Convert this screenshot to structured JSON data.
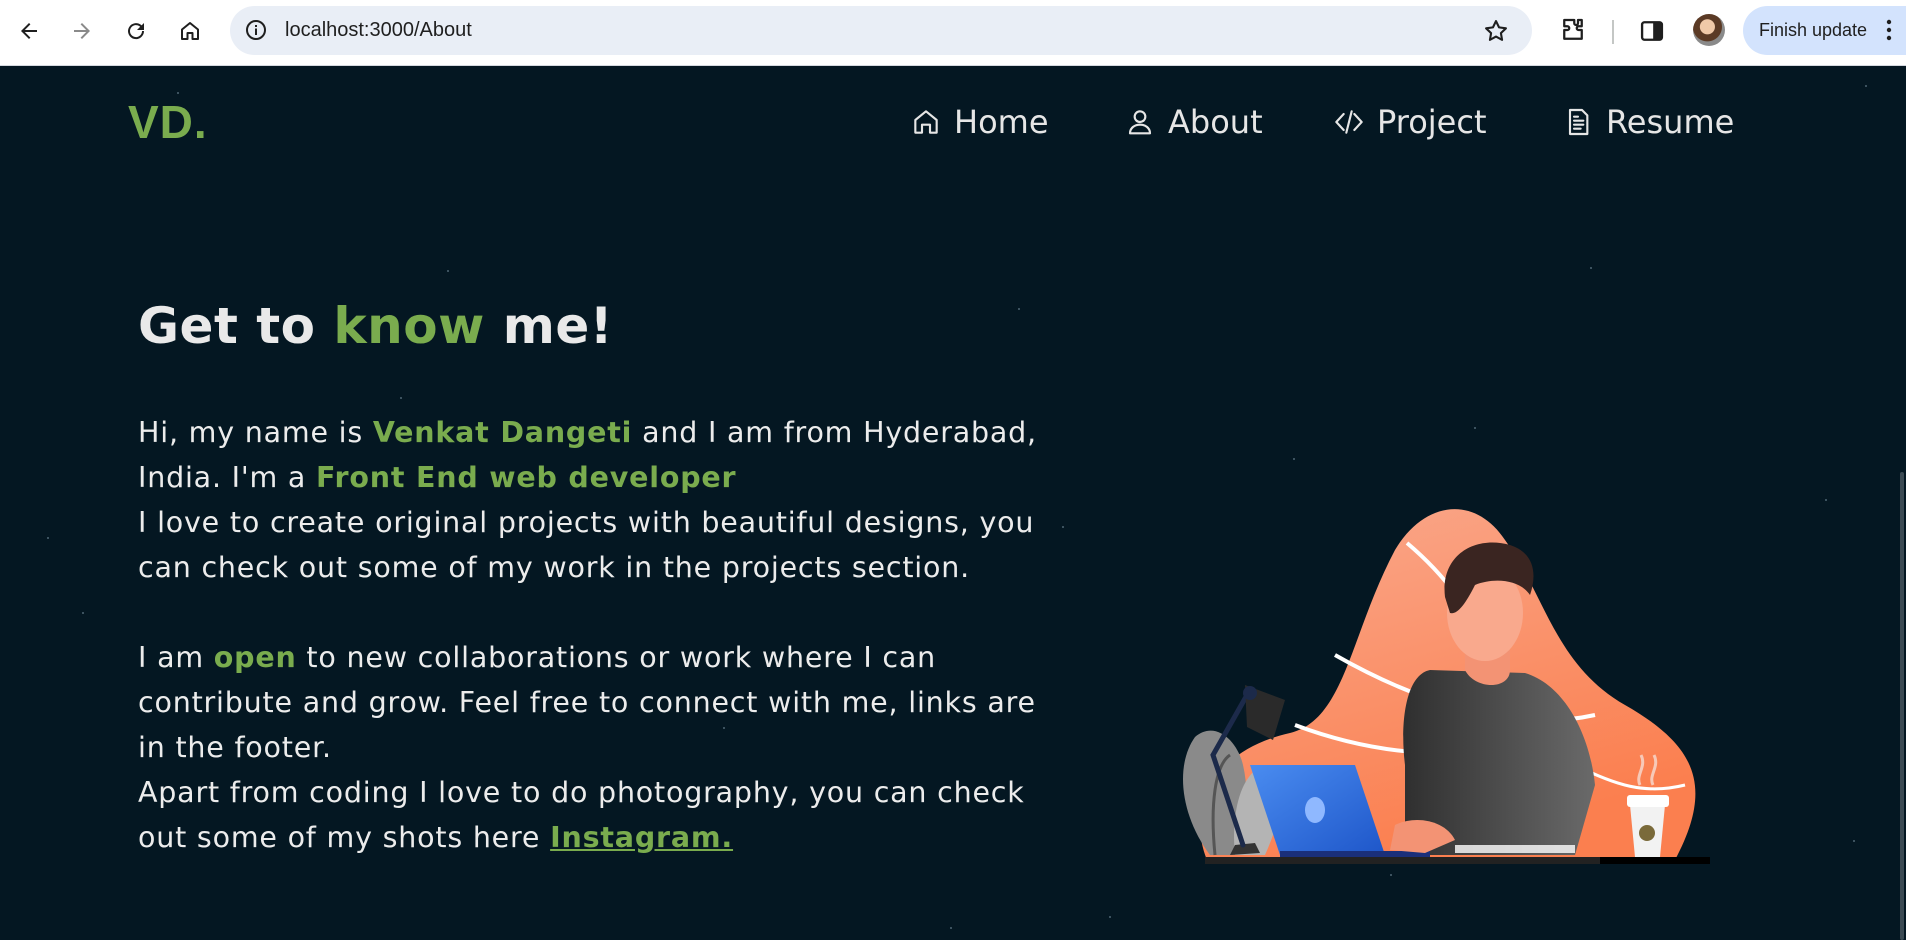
{
  "browser": {
    "url": "localhost:3000/About",
    "finish_update_label": "Finish update",
    "icons": [
      "back-arrow-icon",
      "forward-arrow-icon",
      "reload-icon",
      "home-icon",
      "site-info-icon",
      "bookmark-star-icon",
      "extensions-icon",
      "side-panel-icon",
      "profile-avatar",
      "more-vert-icon"
    ]
  },
  "site": {
    "logo": "VD.",
    "nav": [
      {
        "label": "Home",
        "icon": "home-icon"
      },
      {
        "label": "About",
        "icon": "user-icon"
      },
      {
        "label": "Project",
        "icon": "code-icon"
      },
      {
        "label": "Resume",
        "icon": "document-icon"
      }
    ]
  },
  "about": {
    "headline_pre": "Get to ",
    "headline_accent": "know",
    "headline_post": " me!",
    "p1_a": "Hi, my name is ",
    "p1_name": "Venkat Dangeti",
    "p1_b": " and I am from Hyderabad, India. I'm a ",
    "p1_role": "Front End web developer",
    "p2": "I love to create original projects with beautiful designs, you can check out some of my work in the projects section.",
    "p3_a": "I am ",
    "p3_open": "open",
    "p3_b": " to new collaborations or work where I can contribute and grow. Feel free to connect with me, links are in the footer.",
    "p4": "Apart from coding I love to do photography, you can check out some of my shots here ",
    "p4_link": "Instagram."
  },
  "colors": {
    "background": "#041722",
    "accent": "#7aac4e",
    "text": "#ececec"
  }
}
